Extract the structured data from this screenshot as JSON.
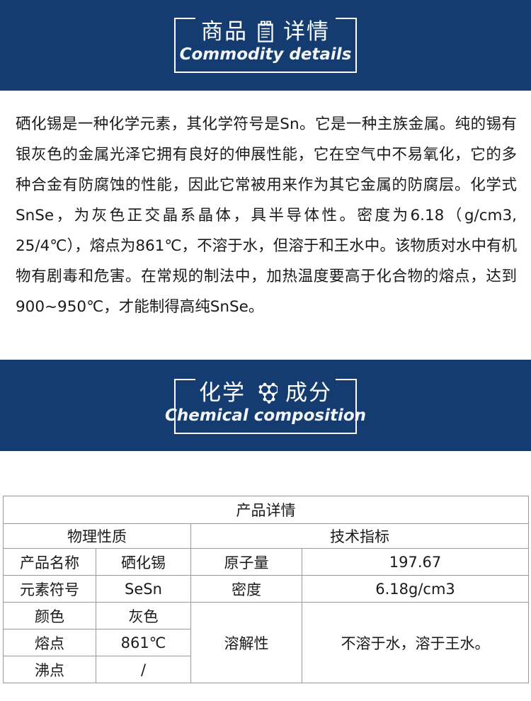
{
  "sections": {
    "commodity": {
      "title_cn_left": "商品",
      "title_cn_right": "详情",
      "subtitle": "Commodity details",
      "icon": "clipboard-icon",
      "background": "#153c71"
    },
    "chemical": {
      "title_cn_left": "化学",
      "title_cn_right": "成分",
      "subtitle": "Chemical composition",
      "icon": "molecule-icon",
      "background": "#153c71"
    }
  },
  "body": {
    "paragraph": "硒化锡是一种化学元素，其化学符号是Sn。它是一种主族金属。纯的锡有银灰色的金属光泽它拥有良好的伸展性能，它在空气中不易氧化，它的多种合金有防腐蚀的性能，因此它常被用来作为其它金属的防腐层。化学式SnSe，为灰色正交晶系晶体，具半导体性。密度为6.18（g/cm3, 25/4℃），熔点为861℃，不溶于水，但溶于和王水中。该物质对水中有机物有剧毒和危害。在常规的制法中，加热温度要高于化合物的熔点，达到900~950℃，才能制得高纯SnSe。"
  },
  "table": {
    "caption": "产品详情",
    "headers": {
      "physical": "物理性质",
      "technical": "技术指标"
    },
    "rows": [
      {
        "label_left": "产品名称",
        "value_left": "硒化锡",
        "label_right": "原子量",
        "value_right": "197.67"
      },
      {
        "label_left": "元素符号",
        "value_left": "SeSn",
        "label_right": "密度",
        "value_right": "6.18g/cm3"
      },
      {
        "label_left": "颜色",
        "value_left": "灰色",
        "label_right": "溶解性",
        "value_right": "不溶于水，溶于王水。"
      },
      {
        "label_left": "熔点",
        "value_left": "861℃"
      },
      {
        "label_left": "沸点",
        "value_left": "/"
      }
    ]
  }
}
